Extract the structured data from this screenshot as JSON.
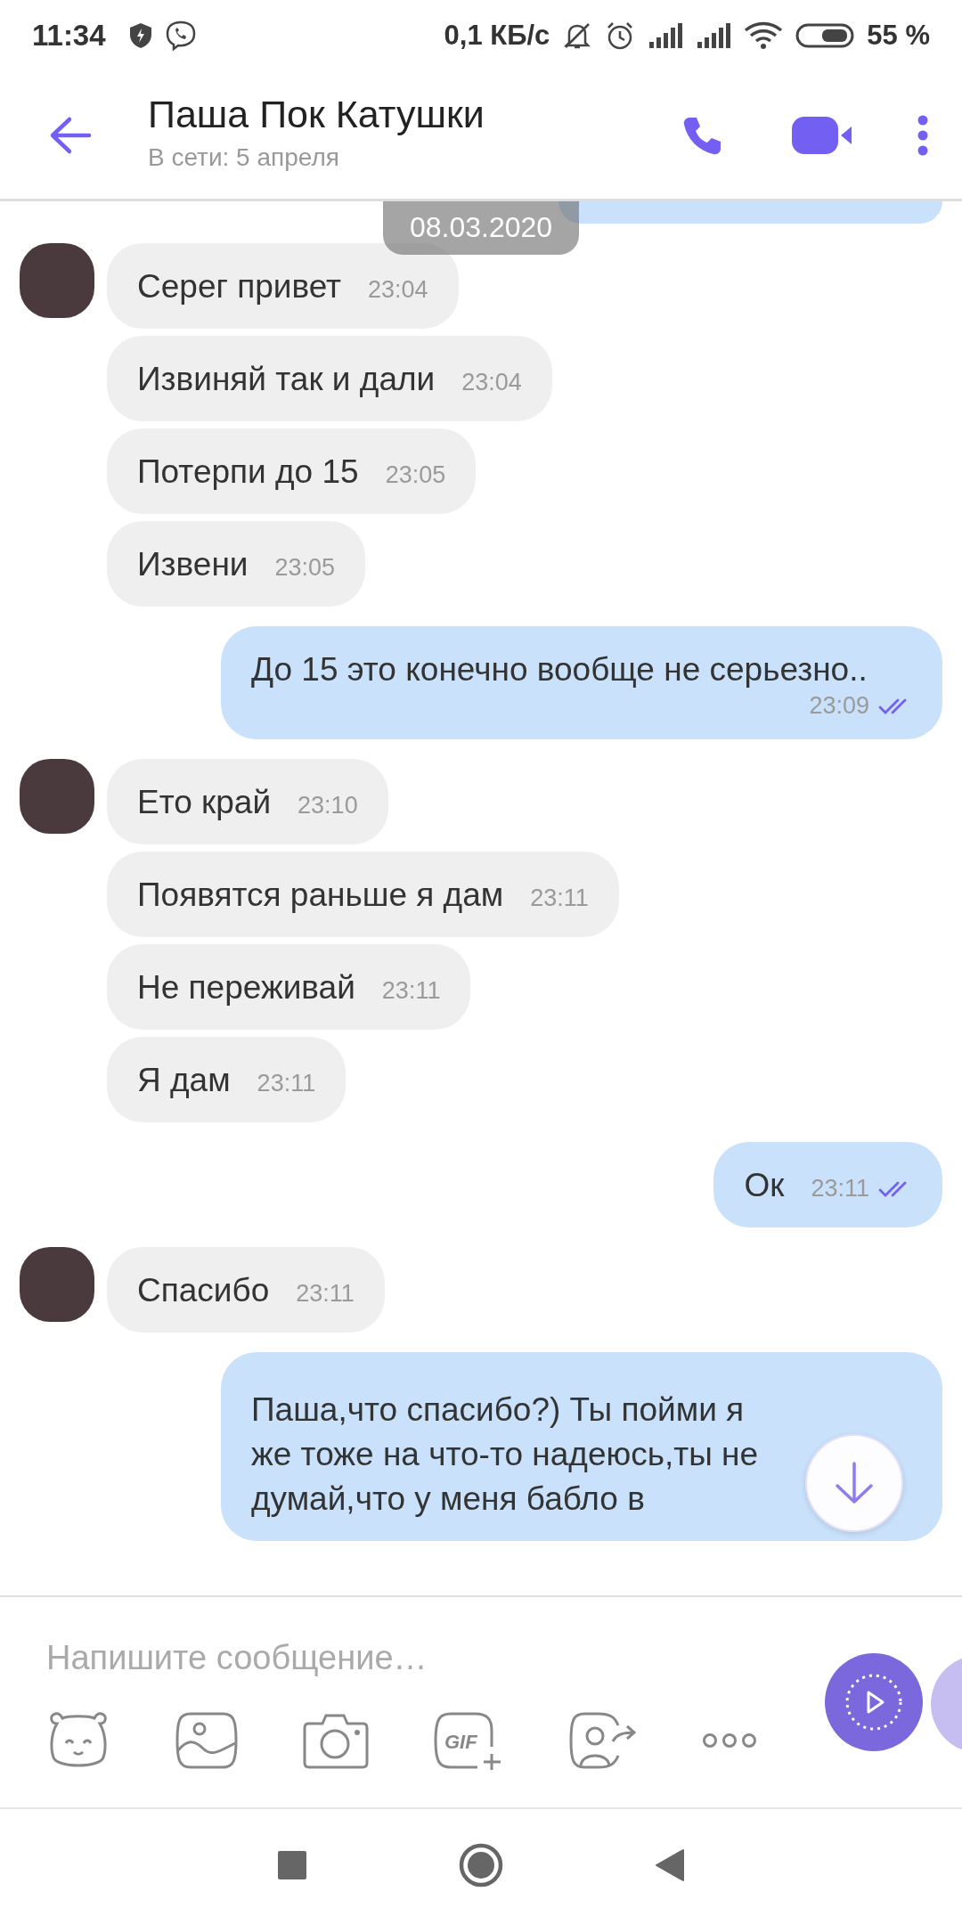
{
  "status_bar": {
    "time": "11:34",
    "net_speed": "0,1 КБ/с",
    "battery": "55 %"
  },
  "header": {
    "title": "Паша Пок Катушки",
    "subtitle": "В сети: 5 апреля"
  },
  "date_chip": "08.03.2020",
  "messages": [
    {
      "kind": "partial"
    },
    {
      "kind": "received",
      "text": "Серег привет",
      "time": "23:04"
    },
    {
      "kind": "received",
      "text": "Извиняй так и дали",
      "time": "23:04"
    },
    {
      "kind": "received",
      "text": "Потерпи до 15",
      "time": "23:05"
    },
    {
      "kind": "received",
      "text": "Извени",
      "time": "23:05"
    },
    {
      "kind": "sent",
      "text": "До 15 это конечно вообще не серьезно..",
      "time": "23:09",
      "read": true
    },
    {
      "kind": "received",
      "text": "Ето край",
      "time": "23:10"
    },
    {
      "kind": "received",
      "text": "Появятся раньше я дам",
      "time": "23:11"
    },
    {
      "kind": "received",
      "text": "Не переживай",
      "time": "23:11"
    },
    {
      "kind": "received",
      "text": "Я дам",
      "time": "23:11"
    },
    {
      "kind": "sent",
      "text": "Ок",
      "time": "23:11",
      "read": true
    },
    {
      "kind": "received",
      "text": "Спасибо",
      "time": "23:11"
    },
    {
      "kind": "sent",
      "text": "Паша,что спасибо?) Ты пойми я же тоже на что-то надеюсь,ты не думай,что у меня бабло в"
    }
  ],
  "composer": {
    "placeholder": "Напишите сообщение…",
    "gif_label": "GIF"
  }
}
